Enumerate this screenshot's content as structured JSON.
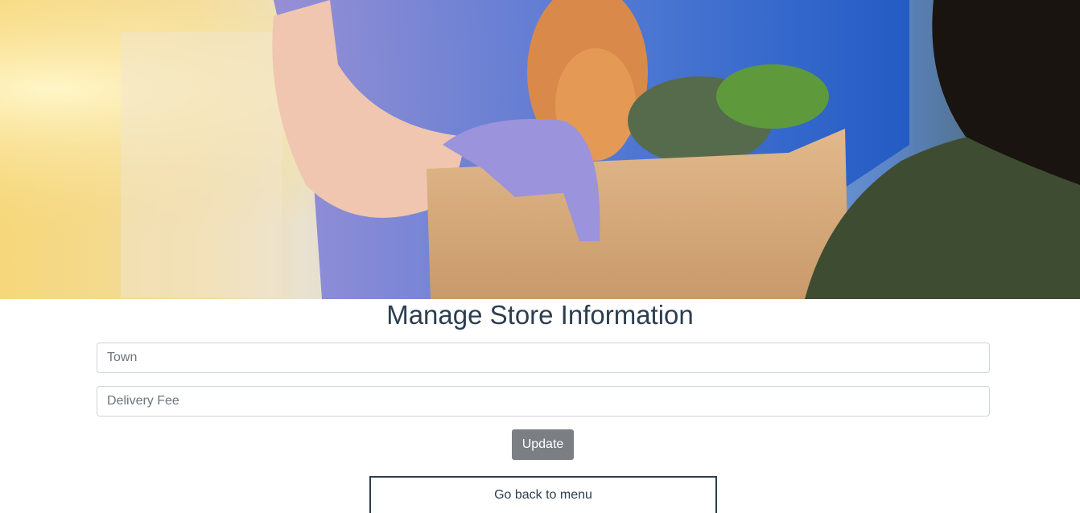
{
  "hero": {
    "image": "grocery-delivery-photo"
  },
  "page": {
    "title": "Manage Store Information"
  },
  "form": {
    "town_placeholder": "Town",
    "town_value": "",
    "fee_placeholder": "Delivery Fee",
    "fee_value": "",
    "update_label": "Update",
    "update_color": "#7b7f83"
  },
  "nav": {
    "back_label": "Go back to menu"
  },
  "colors": {
    "title": "#2c3e50",
    "input_border": "#ced4da"
  }
}
